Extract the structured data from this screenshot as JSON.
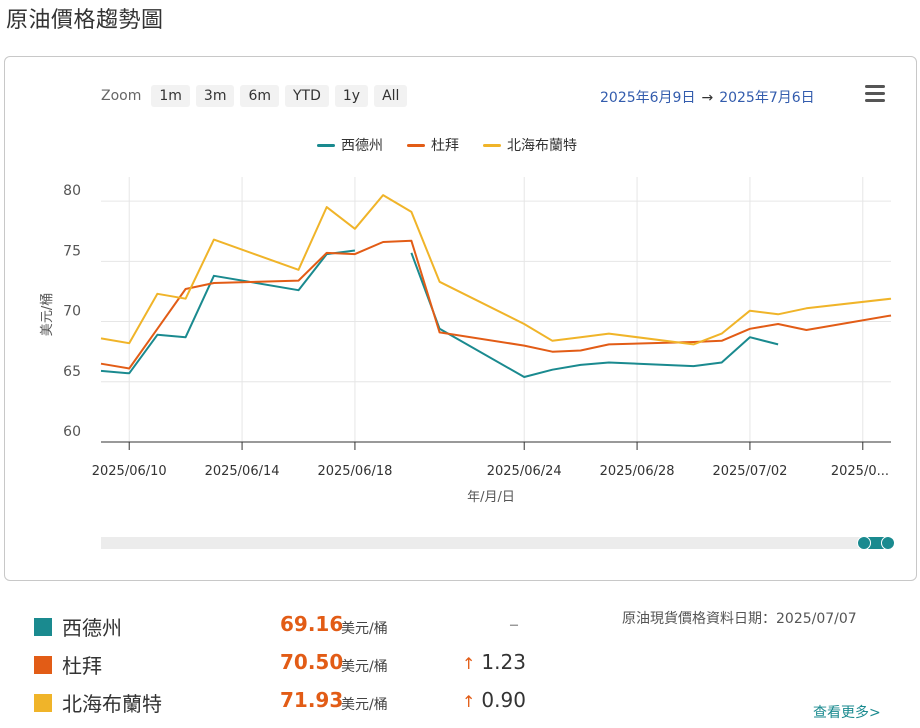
{
  "page": {
    "title": "原油價格趨勢圖"
  },
  "toolbar": {
    "zoom_label": "Zoom",
    "zoom_buttons": [
      "1m",
      "3m",
      "6m",
      "YTD",
      "1y",
      "All"
    ],
    "range_from": "2025年6月9日",
    "range_arrow": "→",
    "range_to": "2025年7月6日",
    "menu_icon": "hamburger-menu-icon"
  },
  "colors": {
    "wti": "#1a8a8f",
    "dubai": "#e25c16",
    "brent": "#f0b429",
    "accent": "#335cad"
  },
  "chart_data": {
    "type": "line",
    "title": "",
    "xlabel": "年/月/日",
    "ylabel": "美元/桶",
    "ylim": [
      60,
      82
    ],
    "yticks": [
      60,
      65,
      70,
      75,
      80
    ],
    "xtick_labels": [
      "2025/06/10",
      "2025/06/14",
      "2025/06/18",
      "2025/06/24",
      "2025/06/28",
      "2025/07/02",
      "2025/0..."
    ],
    "xtick_dates": [
      "2025-06-10",
      "2025-06-14",
      "2025-06-18",
      "2025-06-24",
      "2025-06-28",
      "2025-07-02",
      "2025-07-06"
    ],
    "x_range": [
      "2025-06-09",
      "2025-07-07"
    ],
    "grid": true,
    "legend_position": "top-center",
    "series": [
      {
        "name": "西德州",
        "color": "#1a8a8f",
        "points": [
          [
            "2025-06-09",
            65.9
          ],
          [
            "2025-06-10",
            65.7
          ],
          [
            "2025-06-11",
            68.9
          ],
          [
            "2025-06-12",
            68.7
          ],
          [
            "2025-06-13",
            73.8
          ],
          [
            "2025-06-16",
            72.6
          ],
          [
            "2025-06-17",
            75.6
          ],
          [
            "2025-06-18",
            75.9
          ],
          null,
          [
            "2025-06-20",
            75.7
          ],
          [
            "2025-06-21",
            69.4
          ],
          [
            "2025-06-24",
            65.4
          ],
          [
            "2025-06-25",
            66.0
          ],
          [
            "2025-06-26",
            66.4
          ],
          [
            "2025-06-27",
            66.6
          ],
          [
            "2025-06-30",
            66.3
          ],
          [
            "2025-07-01",
            66.6
          ],
          [
            "2025-07-02",
            68.7
          ],
          [
            "2025-07-03",
            68.1
          ]
        ]
      },
      {
        "name": "杜拜",
        "color": "#e25c16",
        "points": [
          [
            "2025-06-09",
            66.5
          ],
          [
            "2025-06-10",
            66.1
          ],
          [
            "2025-06-11",
            69.4
          ],
          [
            "2025-06-12",
            72.7
          ],
          [
            "2025-06-13",
            73.2
          ],
          [
            "2025-06-16",
            73.4
          ],
          [
            "2025-06-17",
            75.7
          ],
          [
            "2025-06-18",
            75.6
          ],
          [
            "2025-06-19",
            76.6
          ],
          [
            "2025-06-20",
            76.7
          ],
          [
            "2025-06-21",
            69.1
          ],
          [
            "2025-06-24",
            68.0
          ],
          [
            "2025-06-25",
            67.5
          ],
          [
            "2025-06-26",
            67.6
          ],
          [
            "2025-06-27",
            68.1
          ],
          [
            "2025-06-30",
            68.3
          ],
          [
            "2025-07-01",
            68.4
          ],
          [
            "2025-07-02",
            69.4
          ],
          [
            "2025-07-03",
            69.8
          ],
          [
            "2025-07-04",
            69.3
          ],
          [
            "2025-07-07",
            70.5
          ]
        ]
      },
      {
        "name": "北海布蘭特",
        "color": "#f0b429",
        "points": [
          [
            "2025-06-09",
            68.6
          ],
          [
            "2025-06-10",
            68.2
          ],
          [
            "2025-06-11",
            72.3
          ],
          [
            "2025-06-12",
            71.9
          ],
          [
            "2025-06-13",
            76.8
          ],
          [
            "2025-06-16",
            74.3
          ],
          [
            "2025-06-17",
            79.5
          ],
          [
            "2025-06-18",
            77.7
          ],
          [
            "2025-06-19",
            80.5
          ],
          [
            "2025-06-20",
            79.1
          ],
          [
            "2025-06-21",
            73.3
          ],
          [
            "2025-06-24",
            69.8
          ],
          [
            "2025-06-25",
            68.4
          ],
          [
            "2025-06-26",
            68.7
          ],
          [
            "2025-06-27",
            69.0
          ],
          [
            "2025-06-30",
            68.1
          ],
          [
            "2025-07-01",
            69.0
          ],
          [
            "2025-07-02",
            70.9
          ],
          [
            "2025-07-03",
            70.6
          ],
          [
            "2025-07-04",
            71.1
          ],
          [
            "2025-07-07",
            71.9
          ]
        ]
      }
    ]
  },
  "summary": {
    "unit": "美元/桶",
    "data_date": "原油現貨價格資料日期：2025/07/07",
    "see_more": "查看更多>",
    "rows": [
      {
        "name": "西德州",
        "price": "69.16",
        "change": "",
        "dash": "–",
        "color": "#1a8a8f"
      },
      {
        "name": "杜拜",
        "price": "70.50",
        "change": "1.23",
        "arrow": "↑",
        "color": "#e25c16"
      },
      {
        "name": "北海布蘭特",
        "price": "71.93",
        "change": "0.90",
        "arrow": "↑",
        "color": "#f0b429"
      }
    ]
  }
}
